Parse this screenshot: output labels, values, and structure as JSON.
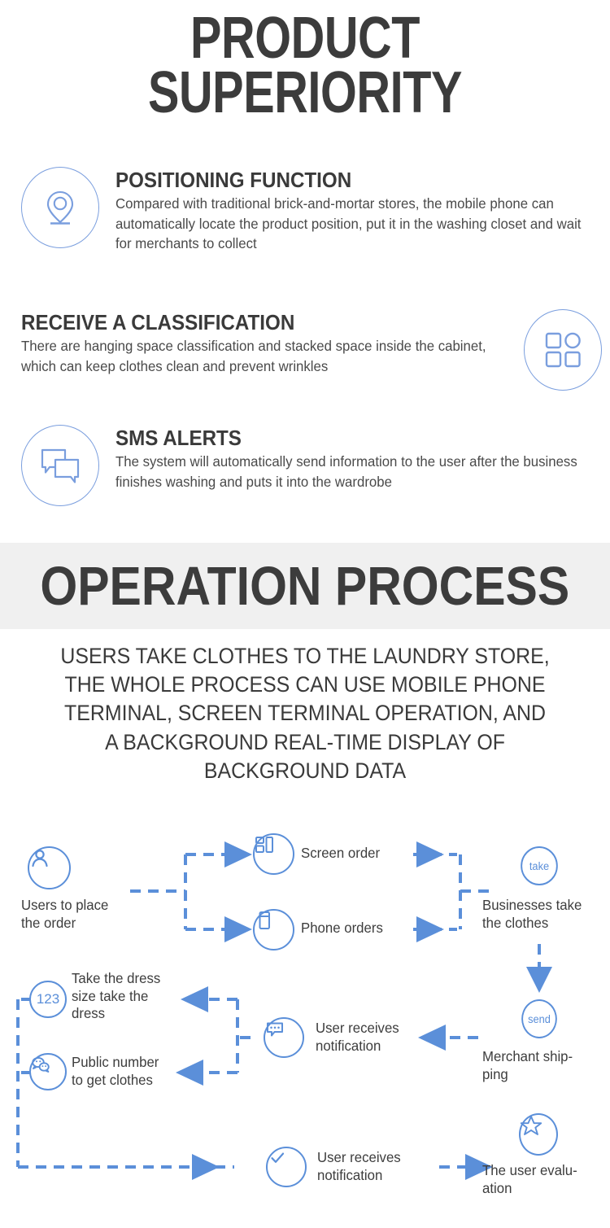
{
  "header": {
    "title_line1": "PRODUCT",
    "title_line2": "SUPERIORITY"
  },
  "features": [
    {
      "icon": "location-pin-icon",
      "title": "POSITIONING FUNCTION",
      "body": "Compared with traditional brick-and-mortar stores, the mobile phone can automatically locate the product position, put it in the washing closet and wait for merchants to collect"
    },
    {
      "icon": "grid-classification-icon",
      "title": "RECEIVE A CLASSIFICATION",
      "body": "There are hanging space classification and stacked space inside the cabinet, which can keep clothes clean and prevent wrinkles"
    },
    {
      "icon": "chat-bubbles-icon",
      "title": "SMS ALERTS",
      "body": "The system will automatically send information to the user after the business finishes washing and puts it into the wardrobe"
    }
  ],
  "banner": {
    "title": "OPERATION PROCESS"
  },
  "subtitle": {
    "line1": "USERS TAKE CLOTHES TO THE LAUNDRY STORE,",
    "line2": "THE WHOLE PROCESS CAN USE MOBILE PHONE",
    "line3": "TERMINAL, SCREEN TERMINAL OPERATION, AND",
    "line4": "A BACKGROUND REAL-TIME DISPLAY OF",
    "line5": "BACKGROUND DATA"
  },
  "flow": {
    "nodes": {
      "user_order": {
        "icon": "user-icon",
        "label_line1": "Users to place",
        "label_line2": "the order"
      },
      "screen_order": {
        "icon": "screen-order-icon",
        "label": "Screen order"
      },
      "phone_orders": {
        "icon": "phone-order-icon",
        "label": "Phone orders"
      },
      "take": {
        "icon": "take-badge",
        "badge": "take",
        "label_line1": "Businesses take",
        "label_line2": "the clothes"
      },
      "send": {
        "icon": "send-badge",
        "badge": "send",
        "label_line1": "Merchant ship-",
        "label_line2": "ping"
      },
      "notify_mid": {
        "icon": "message-dots-icon",
        "label_line1": "User receives",
        "label_line2": "notification"
      },
      "take_dress": {
        "icon": "number-123-icon",
        "badge": "123",
        "label_line1": "Take the dress",
        "label_line2": "size take the",
        "label_line3": "dress"
      },
      "public_number": {
        "icon": "wechat-icon",
        "label_line1": "Public number",
        "label_line2": "to get clothes"
      },
      "notify_bottom": {
        "icon": "check-circle-icon",
        "label_line1": "User receives",
        "label_line2": "notification"
      },
      "evaluation": {
        "icon": "star-rating-icon",
        "label_line1": "The user evalu-",
        "label_line2": "ation"
      }
    }
  },
  "colors": {
    "accent_blue": "#5b8fd9",
    "icon_blue": "#7a9ede",
    "text_dark": "#3c3c3c",
    "banner_bg": "#f0f0f0"
  }
}
